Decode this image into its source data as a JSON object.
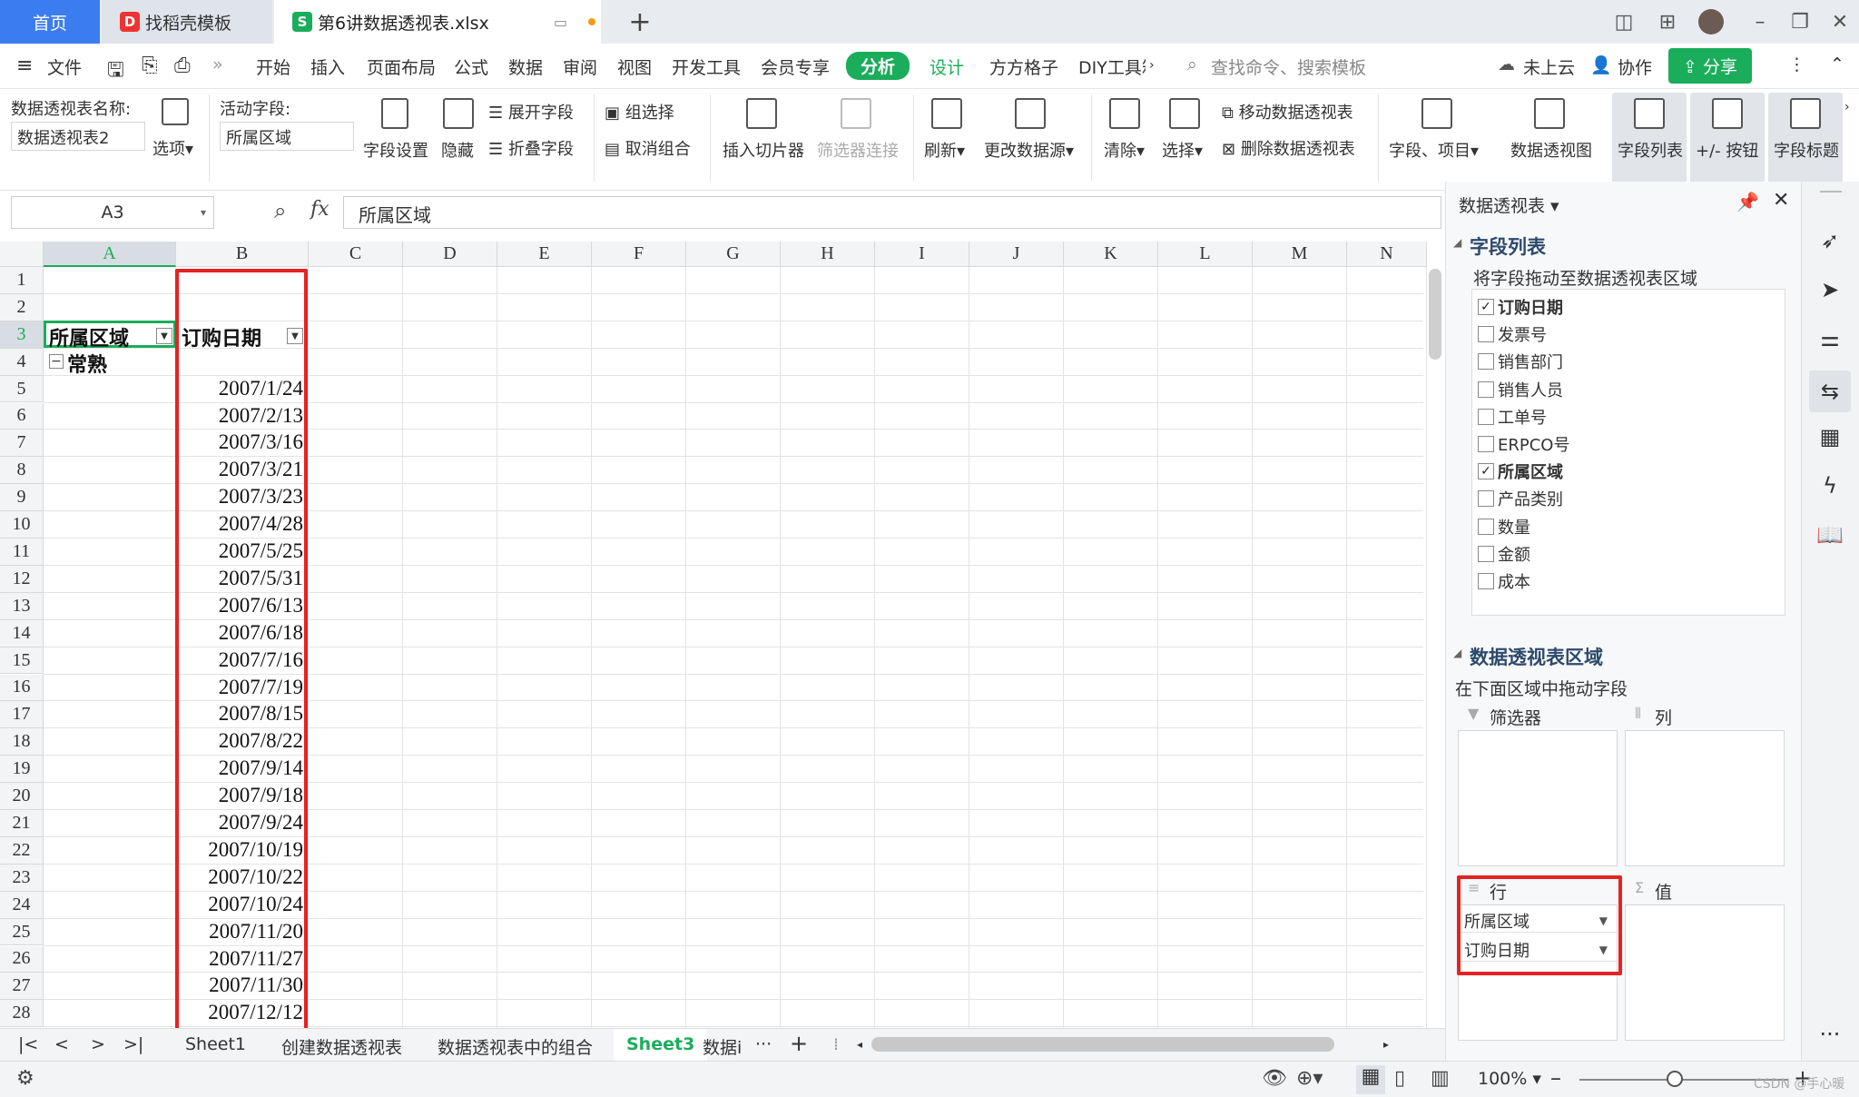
{
  "titlebar": {
    "tabs": [
      {
        "label": "首页"
      },
      {
        "label": "找稻壳模板"
      },
      {
        "label": "第6讲数据透视表.xlsx"
      }
    ],
    "new_tab": "+"
  },
  "menubar": {
    "items": [
      "文件",
      "开始",
      "插入",
      "页面布局",
      "公式",
      "数据",
      "审阅",
      "视图",
      "开发工具",
      "会员专享",
      "分析",
      "设计",
      "方方格子",
      "DIY工具箱"
    ],
    "search_placeholder": "查找命令、搜索模板",
    "cloud": "未上云",
    "collab": "协作",
    "share": "分享"
  },
  "ribbon": {
    "pivot_name_label": "数据透视表名称:",
    "pivot_name_value": "数据透视表2",
    "options": "选项",
    "active_field_label": "活动字段:",
    "active_field_value": "所属区域",
    "field_settings": "字段设置",
    "hide": "隐藏",
    "expand_field": "展开字段",
    "collapse_field": "折叠字段",
    "group_selection": "组选择",
    "ungroup": "取消组合",
    "insert_slicer": "插入切片器",
    "filter_connection": "筛选器连接",
    "refresh": "刷新",
    "change_source": "更改数据源",
    "clear": "清除",
    "select": "选择",
    "move_pivot": "移动数据透视表",
    "delete_pivot": "删除数据透视表",
    "fields_items": "字段、项目",
    "pivot_view": "数据透视图",
    "field_list": "字段列表",
    "plus_minus": "+/- 按钮",
    "field_headers": "字段标题"
  },
  "formula_bar": {
    "name_box": "A3",
    "fx": "fx",
    "formula": "所属区域"
  },
  "grid": {
    "columns": [
      "A",
      "B",
      "C",
      "D",
      "E",
      "F",
      "G",
      "H",
      "I",
      "J",
      "K",
      "L",
      "M",
      "N"
    ],
    "rows": [
      "1",
      "2",
      "3",
      "4",
      "5",
      "6",
      "7",
      "8",
      "9",
      "10",
      "11",
      "12",
      "13",
      "14",
      "15",
      "16",
      "17",
      "18",
      "19",
      "20",
      "21",
      "22",
      "23",
      "24",
      "25",
      "26",
      "27",
      "28"
    ],
    "header_a3": "所属区域",
    "header_b3": "订购日期",
    "group_a4": "常熟",
    "group_toggle": "−",
    "dates": [
      "2007/1/24",
      "2007/2/13",
      "2007/3/16",
      "2007/3/21",
      "2007/3/23",
      "2007/4/28",
      "2007/5/25",
      "2007/5/31",
      "2007/6/13",
      "2007/6/18",
      "2007/7/16",
      "2007/7/19",
      "2007/8/15",
      "2007/8/22",
      "2007/9/14",
      "2007/9/18",
      "2007/9/24",
      "2007/10/19",
      "2007/10/22",
      "2007/10/24",
      "2007/11/20",
      "2007/11/27",
      "2007/11/30",
      "2007/12/12"
    ]
  },
  "sheets": {
    "tabs": [
      "Sheet1",
      "创建数据透视表",
      "数据透视表中的组合",
      "Sheet3",
      "数据i"
    ],
    "active": "Sheet3",
    "more": "···",
    "add": "+"
  },
  "panel": {
    "title": "数据透视表",
    "field_list_title": "字段列表",
    "field_list_hint": "将字段拖动至数据透视表区域",
    "fields": [
      {
        "name": "订购日期",
        "checked": true
      },
      {
        "name": "发票号",
        "checked": false
      },
      {
        "name": "销售部门",
        "checked": false
      },
      {
        "name": "销售人员",
        "checked": false
      },
      {
        "name": "工单号",
        "checked": false
      },
      {
        "name": "ERPCO号",
        "checked": false
      },
      {
        "name": "所属区域",
        "checked": true
      },
      {
        "name": "产品类别",
        "checked": false
      },
      {
        "name": "数量",
        "checked": false
      },
      {
        "name": "金额",
        "checked": false
      },
      {
        "name": "成本",
        "checked": false
      }
    ],
    "areas_title": "数据透视表区域",
    "areas_hint": "在下面区域中拖动字段",
    "filter_label": "筛选器",
    "columns_label": "列",
    "rows_label": "行",
    "values_label": "值",
    "row_fields": [
      "所属区域",
      "订购日期"
    ]
  },
  "status": {
    "zoom": "100%",
    "watermark": "CSDN @手心暖"
  },
  "colors": {
    "accent_green": "#1aad5b",
    "home_tab_blue": "#3b7cf0",
    "highlight_red": "#e52222"
  }
}
